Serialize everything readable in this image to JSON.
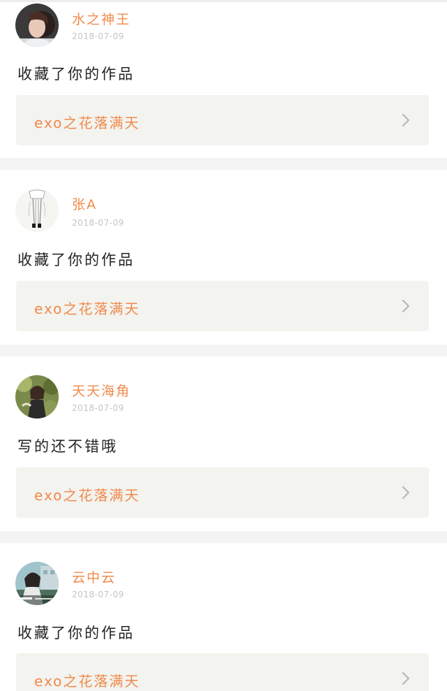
{
  "feed": {
    "items": [
      {
        "username": "水之神王",
        "date": "2018-07-09",
        "message": "收藏了你的作品",
        "work_title": "exo之花落满天",
        "avatar_icon": "avatar-photo-girl",
        "chevron_icon": "chevron-right-icon"
      },
      {
        "username": "张A",
        "date": "2018-07-09",
        "message": "收藏了你的作品",
        "work_title": "exo之花落满天",
        "avatar_icon": "avatar-sketch-legs",
        "chevron_icon": "chevron-right-icon"
      },
      {
        "username": "天天海角",
        "date": "2018-07-09",
        "message": "写的还不错哦",
        "work_title": "exo之花落满天",
        "avatar_icon": "avatar-photo-garden",
        "chevron_icon": "chevron-right-icon"
      },
      {
        "username": "云中云",
        "date": "2018-07-09",
        "message": "收藏了你的作品",
        "work_title": "exo之花落满天",
        "avatar_icon": "avatar-photo-street",
        "chevron_icon": "chevron-right-icon"
      }
    ]
  },
  "colors": {
    "accent": "#f08a4b",
    "date_text": "#c4c4c4",
    "message_text": "#222222",
    "link_bg": "#f3f3ef",
    "divider": "#f4f4f4",
    "chevron": "#b8b8b8"
  }
}
